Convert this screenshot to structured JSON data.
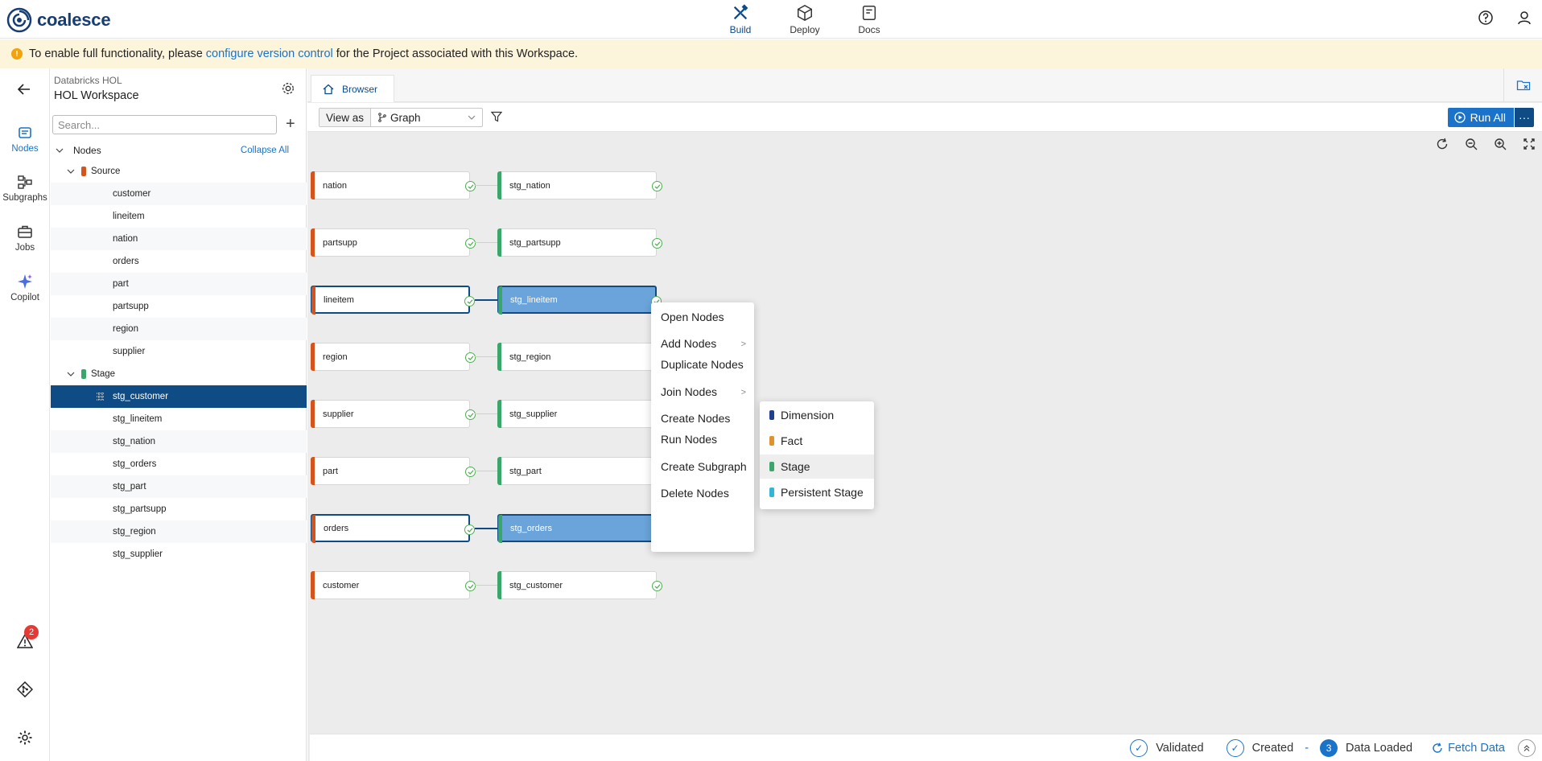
{
  "app": {
    "name": "coalesce"
  },
  "topnav": [
    {
      "label": "Build",
      "icon": "build-icon",
      "active": true
    },
    {
      "label": "Deploy",
      "icon": "deploy-icon",
      "active": false
    },
    {
      "label": "Docs",
      "icon": "docs-icon",
      "active": false
    }
  ],
  "banner": {
    "prefix": "To enable full functionality, please",
    "link": "configure version control",
    "suffix": "for the Project associated with this Workspace."
  },
  "rail": {
    "items": [
      {
        "label": "Nodes",
        "icon": "nodes-icon",
        "active": true
      },
      {
        "label": "Subgraphs",
        "icon": "subgraphs-icon",
        "active": false
      },
      {
        "label": "Jobs",
        "icon": "jobs-icon",
        "active": false
      },
      {
        "label": "Copilot",
        "icon": "copilot-icon",
        "active": false
      }
    ],
    "alert_count": "2"
  },
  "workspace": {
    "project": "Databricks HOL",
    "name": "HOL Workspace"
  },
  "search": {
    "placeholder": "Search..."
  },
  "tree": {
    "root": "Nodes",
    "collapse_all": "Collapse All",
    "groups": [
      {
        "label": "Source",
        "color": "#d4541c",
        "items": [
          "customer",
          "lineitem",
          "nation",
          "orders",
          "part",
          "partsupp",
          "region",
          "supplier"
        ]
      },
      {
        "label": "Stage",
        "color": "#3aa66a",
        "items": [
          "stg_customer",
          "stg_lineitem",
          "stg_nation",
          "stg_orders",
          "stg_part",
          "stg_partsupp",
          "stg_region",
          "stg_supplier"
        ]
      }
    ],
    "selected": "stg_customer"
  },
  "tabs": {
    "browser": "Browser"
  },
  "toolbar": {
    "view_as_label": "View as",
    "view_as_value": "Graph",
    "run_all": "Run All"
  },
  "graph": {
    "rows": [
      {
        "source": "nation",
        "stage": "stg_nation",
        "selected": false
      },
      {
        "source": "partsupp",
        "stage": "stg_partsupp",
        "selected": false
      },
      {
        "source": "lineitem",
        "stage": "stg_lineitem",
        "selected": true
      },
      {
        "source": "region",
        "stage": "stg_region",
        "selected": false
      },
      {
        "source": "supplier",
        "stage": "stg_supplier",
        "selected": false
      },
      {
        "source": "part",
        "stage": "stg_part",
        "selected": false
      },
      {
        "source": "orders",
        "stage": "stg_orders",
        "selected": true
      },
      {
        "source": "customer",
        "stage": "stg_customer",
        "selected": false
      }
    ],
    "source_color": "#d4541c",
    "stage_color": "#3aa66a"
  },
  "context_menu": {
    "items": [
      "Open Nodes",
      "Add Nodes",
      "Duplicate Nodes",
      "Join Nodes",
      "Create Nodes",
      "Run Nodes",
      "Create Subgraph",
      "Delete Nodes"
    ]
  },
  "join_submenu": [
    {
      "label": "Dimension",
      "color": "#1f3f8f"
    },
    {
      "label": "Fact",
      "color": "#e0922f"
    },
    {
      "label": "Stage",
      "color": "#3aa66a"
    },
    {
      "label": "Persistent Stage",
      "color": "#33b5d6"
    }
  ],
  "status": {
    "validated": "Validated",
    "created": "Created",
    "separator": "-",
    "loaded_count": "3",
    "data_loaded": "Data Loaded",
    "fetch": "Fetch Data"
  }
}
